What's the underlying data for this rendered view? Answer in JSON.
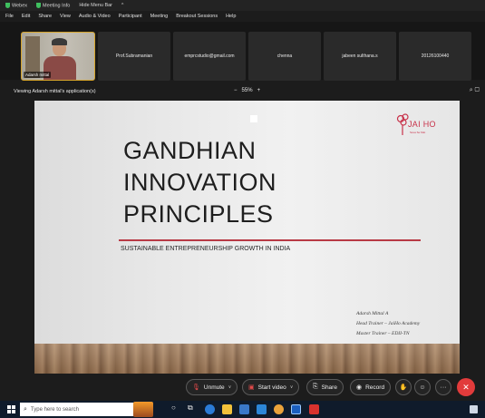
{
  "topbar": {
    "app": "Webex",
    "meeting_info": "Meeting Info",
    "hide_menu": "Hide Menu Bar",
    "hide_menu_chevron": "^"
  },
  "menu": {
    "items": [
      "File",
      "Edit",
      "Share",
      "View",
      "Audio & Video",
      "Participant",
      "Meeting",
      "Breakout Sessions",
      "Help"
    ]
  },
  "participants": {
    "self_name": "Adarsh mittal",
    "tiles": [
      "Prof.Subramanian",
      "emprcstudio@gmail.com",
      "chenna",
      "jabeen sulthana.s",
      "20126100440"
    ]
  },
  "viewbar": {
    "text": "Viewing Adarsh mittal's application(s)",
    "zoom": "55%",
    "zoom_minus": "−",
    "zoom_plus": "+",
    "right_icons": "⌕  ▢"
  },
  "slide": {
    "title_line1": "GANDHIAN",
    "title_line2": "INNOVATION",
    "title_line3": "PRINCIPLES",
    "subtitle": "SUSTAINABLE ENTREPRENEURSHIP GROWTH IN INDIA",
    "logo_text": "JAI HO",
    "logo_tag": "Seva Se Mat",
    "sig_name": "Adarsh Mittal A",
    "sig_role1": "Head Trainer – JaiHo Academy",
    "sig_role2": "Master Trainer – EDII-TN"
  },
  "controls": {
    "unmute": "Unmute",
    "start_video": "Start video",
    "share": "Share",
    "record": "Record",
    "dropdown": "∨",
    "more": "···",
    "leave": "✕"
  },
  "taskbar": {
    "search_placeholder": "Type here to search"
  },
  "colors": {
    "accent_red": "#e23b3b",
    "slide_rule": "#b83a45",
    "logo_red": "#c8324a",
    "self_border": "#d4a32a"
  }
}
